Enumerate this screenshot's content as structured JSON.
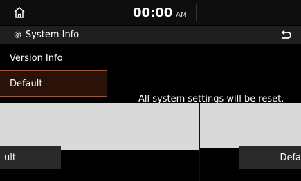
{
  "status_bar": {
    "time": "00:00",
    "ampm": "AM",
    "home_icon": "home-icon"
  },
  "title_bar": {
    "icon": "gear-icon",
    "title": "System Info",
    "back_icon": "back-arrow-icon"
  },
  "menu": {
    "items": [
      {
        "label": "Version Info"
      },
      {
        "label": "Default"
      }
    ]
  },
  "dialog": {
    "message": "All system settings will be reset.",
    "cancel_label": "ult",
    "confirm_label": "Defa"
  },
  "colors": {
    "accent": "#c8460e",
    "active_bg": "#2b1208",
    "popup_bg": "#d9d9d9"
  }
}
